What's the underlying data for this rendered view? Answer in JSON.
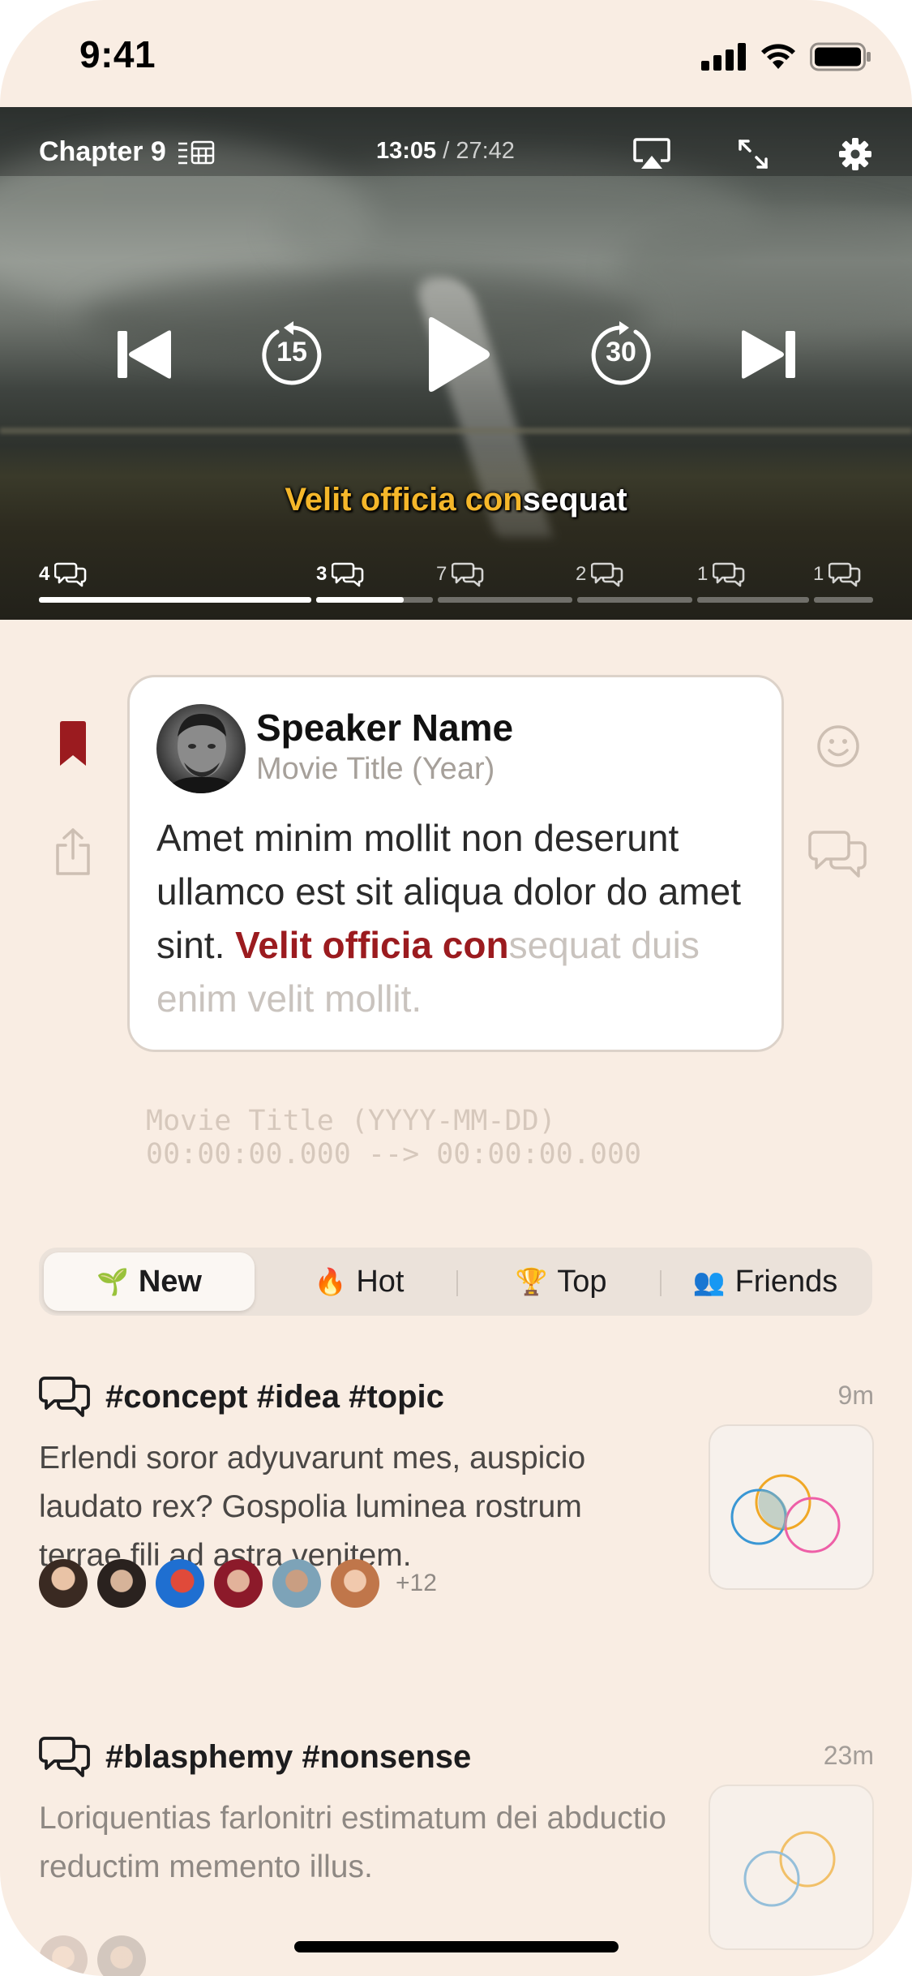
{
  "status_bar": {
    "time": "9:41"
  },
  "player": {
    "chapter_label": "Chapter 9",
    "time_current": "13:05",
    "time_separator": " / ",
    "time_total": "27:42",
    "skip_back_seconds": "15",
    "skip_forward_seconds": "30",
    "subtitle_highlight": "Velit officia con",
    "subtitle_rest": "sequat",
    "chapter_markers": [
      "4",
      "3",
      "7",
      "2",
      "1",
      "1"
    ],
    "progress_in_current_chapter": 0.75
  },
  "quote_card": {
    "speaker_name": "Speaker Name",
    "movie_line": "Movie Title (Year)",
    "text_plain": "Amet minim mollit non deserunt ullamco est sit aliqua dolor do amet sint. ",
    "text_highlight": "Velit officia con",
    "text_faded": "sequat duis enim velit mollit."
  },
  "srt_preview": {
    "line1": "Movie Title (YYYY-MM-DD)",
    "line2": "00:00:00.000 --> 00:00:00.000"
  },
  "tabs": [
    {
      "label": "New",
      "emoji": "🌱",
      "active": true
    },
    {
      "label": "Hot",
      "emoji": "🔥",
      "active": false
    },
    {
      "label": "Top",
      "emoji": "🏆",
      "active": false
    },
    {
      "label": "Friends",
      "emoji": "👥",
      "active": false
    }
  ],
  "posts": [
    {
      "tags": "#concept #idea #topic",
      "time": "9m",
      "body": "Erlendi soror adyuvarunt mes, auspicio laudato rex? Gospolia luminea rostrum terrae fili ad astra venitem.",
      "participants_more": "+12"
    },
    {
      "tags": "#blasphemy #nonsense",
      "time": "23m",
      "body": "Loriquentias farlonitri estimatum dei abductio reductim memento illus."
    }
  ],
  "colors": {
    "background": "#f9ede3",
    "accent_red": "#9b1b1f",
    "subtitle_highlight": "#f5b72a",
    "card_border": "#dcd2c9"
  }
}
